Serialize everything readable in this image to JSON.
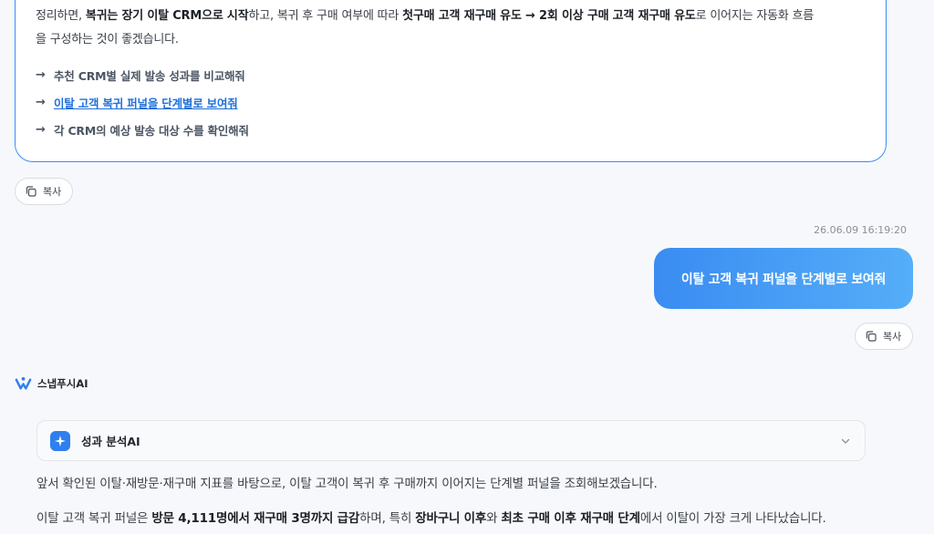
{
  "prev_answer": {
    "summary": {
      "t1": "정리하면, ",
      "b1": "복귀는 장기 이탈 CRM으로 시작",
      "t2": "하고, 복귀 후 구매 여부에 따라 ",
      "b2": "첫구매 고객 재구매 유도 → 2회 이상 구매 고객 재구매 유도",
      "t3": "로 이어지는 자동화 흐름",
      "t4": "을 구성하는 것이 좋겠습니다."
    },
    "suggestions": [
      {
        "arrow": "→",
        "label": "추천 CRM별 실제 발송 성과를 비교해줘"
      },
      {
        "arrow": "→",
        "label": "이탈 고객 복귀 퍼널을 단계별로 보여줘"
      },
      {
        "arrow": "→",
        "label": "각 CRM의 예상 발송 대상 수를 확인해줘"
      }
    ],
    "copy_label": "복사"
  },
  "user_message": {
    "timestamp": "26.06.09 16:19:20",
    "text": "이탈 고객 복귀 퍼널을 단계별로 보여줘",
    "copy_label": "복사"
  },
  "assistant": {
    "brand_name": "스냅푸시AI",
    "agent_label": "성과 분석AI",
    "intro": "앞서 확인된 이탈·재방문·재구매 지표를 바탕으로, 이탈 고객이 복귀 후 구매까지 이어지는 단계별 퍼널을 조회해보겠습니다.",
    "result": {
      "t1": "이탈 고객 복귀 퍼널은 ",
      "b1": "방문 4,111명에서 재구매 3명까지 급감",
      "t2": "하며, 특히 ",
      "b2": "장바구니 이후",
      "t3": "와 ",
      "b3": "최초 구매 이후 재구매 단계",
      "t4": "에서 이탈이 가장 크게 나타났습니다."
    }
  },
  "colors": {
    "accent": "#3b8cf5",
    "link": "#1f6fd8",
    "bubble_start": "#3a8cf2",
    "bubble_end": "#55aef8"
  },
  "icons": {
    "copy": "copy-icon",
    "arrow": "arrow-right-icon",
    "brand": "snappush-logo-icon",
    "agent": "sparkle-icon",
    "expand": "chevron-down-icon"
  }
}
